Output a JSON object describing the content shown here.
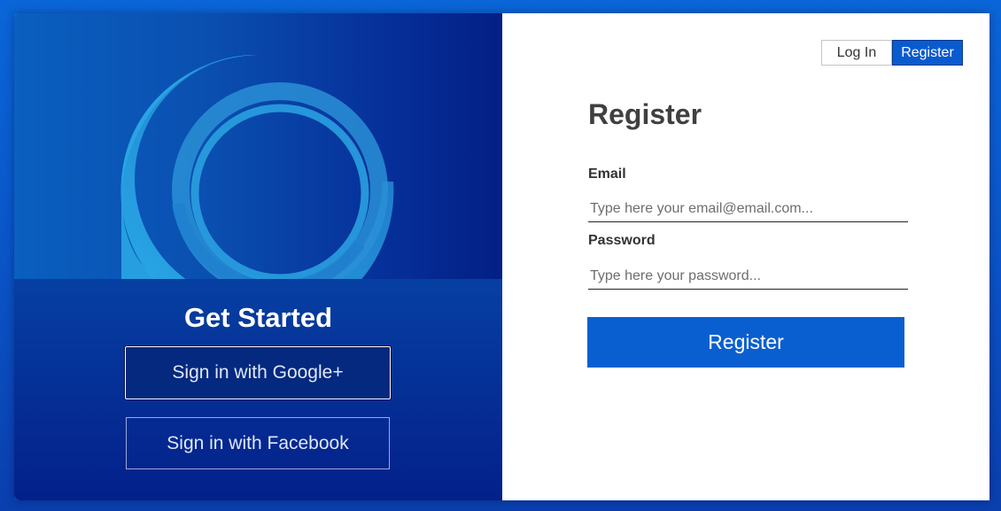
{
  "left": {
    "heading": "Get Started",
    "google_button": "Sign in with Google+",
    "facebook_button": "Sign in with Facebook",
    "hero_icon": "ring-logo-icon"
  },
  "tabs": {
    "login": "Log In",
    "register": "Register",
    "active": "register"
  },
  "form": {
    "title": "Register",
    "email_label": "Email",
    "email_placeholder": "Type here your email@email.com...",
    "password_label": "Password",
    "password_placeholder": "Type here your password...",
    "submit_label": "Register"
  },
  "colors": {
    "accent": "#0a5fd0",
    "background": "#0a55c8",
    "left_panel_dark": "#04208a"
  }
}
